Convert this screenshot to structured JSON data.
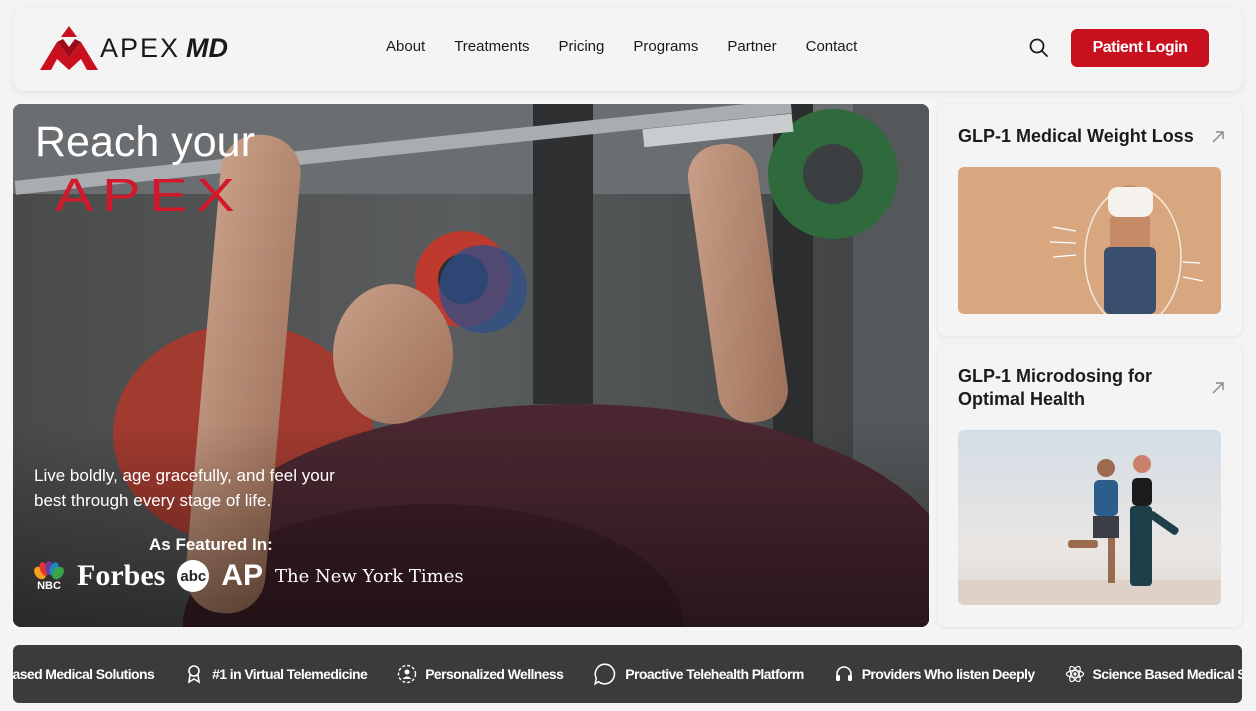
{
  "header": {
    "logo_text": "APEX",
    "logo_md": "MD",
    "nav": [
      "About",
      "Treatments",
      "Pricing",
      "Programs",
      "Partner",
      "Contact"
    ],
    "search_icon": "search-icon",
    "login_label": "Patient Login"
  },
  "hero": {
    "title": "Reach your",
    "apex": "APEX",
    "tagline": "Live boldly, age gracefully, and feel your best through every stage of life.",
    "featured_label": "As Featured In:",
    "press": {
      "nbc": "NBC",
      "forbes": "Forbes",
      "abc": "abc",
      "ap": "AP",
      "nyt": "The New York Times"
    }
  },
  "cards": [
    {
      "title": "GLP-1 Medical Weight Loss",
      "icon": "arrow-up-right-icon"
    },
    {
      "title": "GLP-1 Microdosing for Optimal Health",
      "icon": "arrow-up-right-icon"
    }
  ],
  "marquee": [
    {
      "label": "Based Medical Solutions",
      "icon": ""
    },
    {
      "label": "#1 in Virtual Telemedicine",
      "icon": "award-icon"
    },
    {
      "label": "Personalized Wellness",
      "icon": "person-icon"
    },
    {
      "label": "Proactive Telehealth Platform",
      "icon": "chat-bubble-icon"
    },
    {
      "label": "Providers Who listen Deeply",
      "icon": "headphones-icon"
    },
    {
      "label": "Science Based Medical Solutions",
      "icon": "atom-icon"
    }
  ],
  "colors": {
    "brand_red": "#c8101e",
    "background": "#f4f4f4",
    "marquee_bg": "#3b3b3b"
  }
}
